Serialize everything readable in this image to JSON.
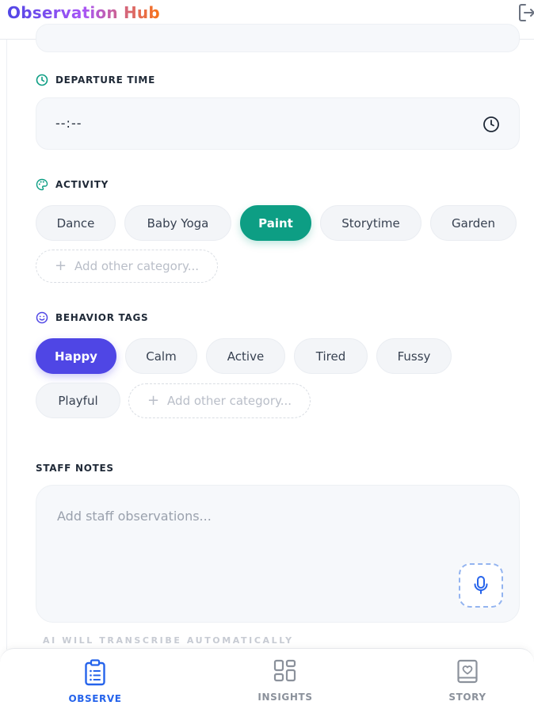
{
  "app": {
    "title": "Observation Hub"
  },
  "colors": {
    "teal": "#0d9e84",
    "indigo": "#4f46e5",
    "blue": "#2563eb"
  },
  "icons": {
    "header_action": "logout-icon",
    "departure": "clock-icon",
    "activity": "palette-icon",
    "behavior": "smile-icon",
    "mic": "microphone-icon"
  },
  "departure": {
    "label": "DEPARTURE TIME",
    "value": "--:--"
  },
  "activity": {
    "label": "ACTIVITY",
    "selected": "Paint",
    "options": [
      "Dance",
      "Baby Yoga",
      "Paint",
      "Storytime",
      "Garden"
    ],
    "add_label": "Add other category..."
  },
  "behavior": {
    "label": "BEHAVIOR TAGS",
    "selected": "Happy",
    "options": [
      "Happy",
      "Calm",
      "Active",
      "Tired",
      "Fussy",
      "Playful"
    ],
    "add_label": "Add other category..."
  },
  "notes": {
    "label": "STAFF NOTES",
    "value": "",
    "placeholder": "Add staff observations...",
    "hint": "AI WILL TRANSCRIBE AUTOMATICALLY"
  },
  "nav": {
    "active": "OBSERVE",
    "items": [
      {
        "label": "OBSERVE",
        "icon": "clipboard-icon"
      },
      {
        "label": "INSIGHTS",
        "icon": "grid-icon"
      },
      {
        "label": "STORY",
        "icon": "heart-book-icon"
      }
    ]
  }
}
